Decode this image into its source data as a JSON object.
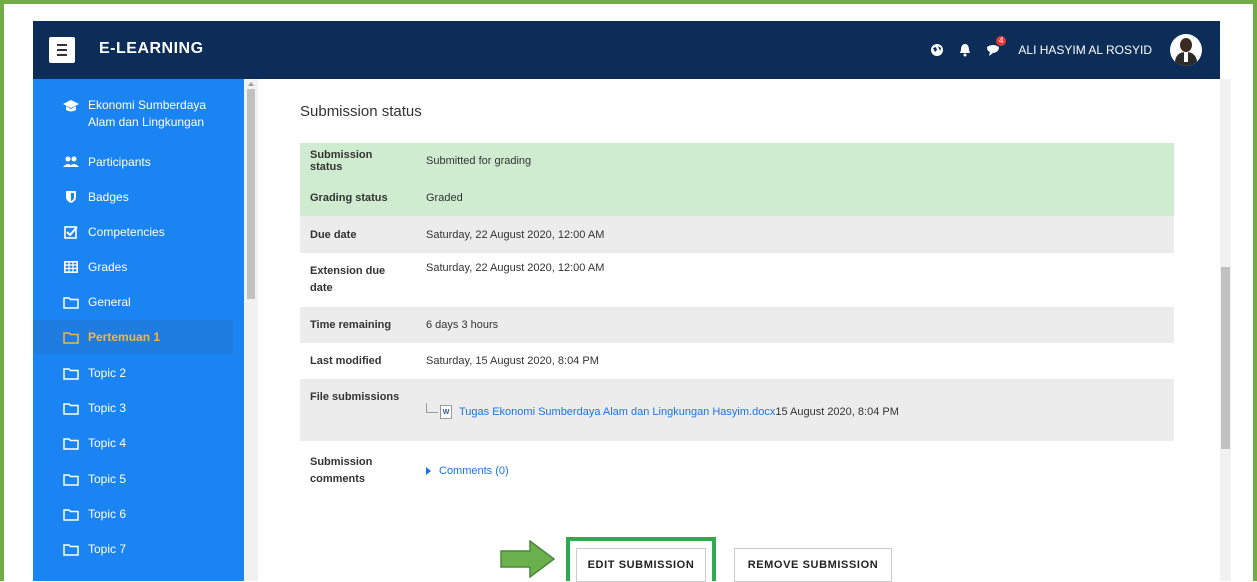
{
  "navbar": {
    "brand": "E-LEARNING",
    "notification_count": "4",
    "username": "ALI HASYIM AL ROSYID",
    "icons": [
      "globe-icon",
      "bell-icon",
      "message-icon"
    ]
  },
  "sidebar": {
    "course": {
      "label": "Ekonomi Sumberdaya\nAlam dan Lingkungan",
      "line1": "Ekonomi Sumberdaya",
      "line2": "Alam dan Lingkungan",
      "icon": "graduation-cap-icon"
    },
    "items": [
      {
        "label": "Participants",
        "icon": "users-icon"
      },
      {
        "label": "Badges",
        "icon": "shield-icon"
      },
      {
        "label": "Competencies",
        "icon": "checkbox-icon"
      },
      {
        "label": "Grades",
        "icon": "table-icon"
      },
      {
        "label": "General",
        "icon": "folder-icon"
      },
      {
        "label": "Pertemuan 1",
        "icon": "folder-icon",
        "active": true
      },
      {
        "label": "Topic 2",
        "icon": "folder-icon"
      },
      {
        "label": "Topic 3",
        "icon": "folder-icon"
      },
      {
        "label": "Topic 4",
        "icon": "folder-icon"
      },
      {
        "label": "Topic 5",
        "icon": "folder-icon"
      },
      {
        "label": "Topic 6",
        "icon": "folder-icon"
      },
      {
        "label": "Topic 7",
        "icon": "folder-icon"
      }
    ]
  },
  "main": {
    "section_title": "Submission status",
    "rows": {
      "submission_status": {
        "label": "Submission status",
        "value": "Submitted for grading"
      },
      "grading_status": {
        "label": "Grading status",
        "value": "Graded"
      },
      "due_date": {
        "label": "Due date",
        "value": "Saturday, 22 August 2020, 12:00 AM"
      },
      "extension_due_date": {
        "label1": "Extension due",
        "label2": "date",
        "value": "Saturday, 22 August 2020, 12:00 AM"
      },
      "time_remaining": {
        "label": "Time remaining",
        "value": "6 days 3 hours"
      },
      "last_modified": {
        "label": "Last modified",
        "value": "Saturday, 15 August 2020, 8:04 PM"
      },
      "file_submissions": {
        "label": "File submissions",
        "file_name": "Tugas Ekonomi Sumberdaya Alam dan Lingkungan Hasyim.docx",
        "file_date": "15 August 2020, 8:04 PM"
      },
      "submission_comments": {
        "label1": "Submission",
        "label2": "comments",
        "value": "Comments (0)"
      }
    },
    "buttons": {
      "edit": "EDIT SUBMISSION",
      "remove": "REMOVE SUBMISSION"
    }
  },
  "colors": {
    "navbar": "#0c2d58",
    "sidebar": "#1a84f2",
    "active_item": "#f7b53d",
    "success_row": "#d0ecd0",
    "highlight_box": "#2eab4e",
    "frame": "#70ad47"
  }
}
